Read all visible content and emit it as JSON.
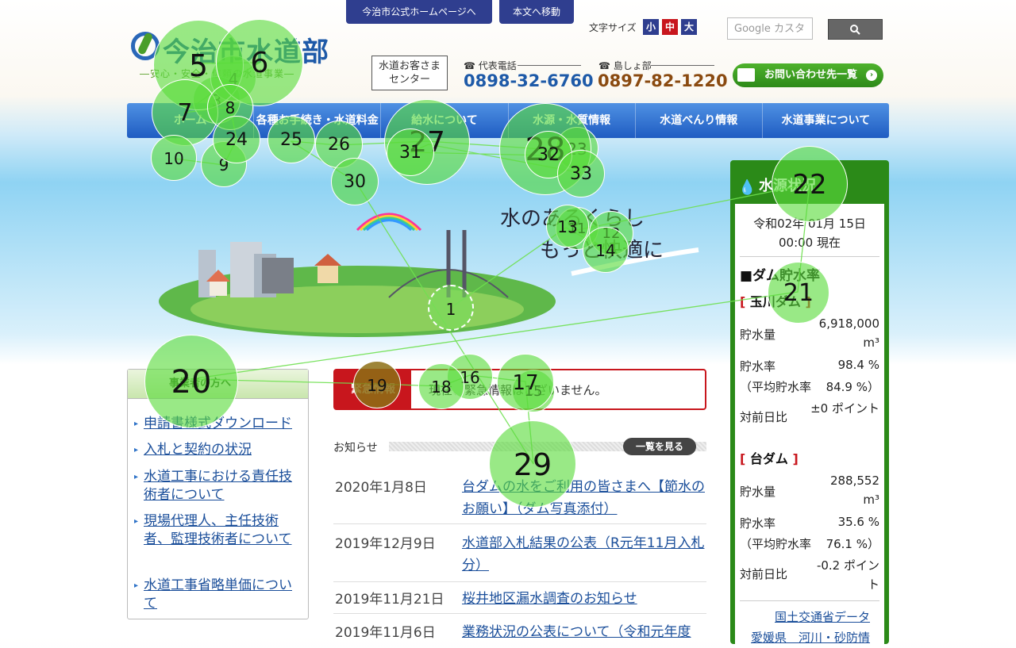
{
  "top": {
    "official_link": "今治市公式ホームページへ",
    "skip_link": "本文へ移動",
    "font_size_label": "文字サイズ",
    "font_sizes": [
      "小",
      "中",
      "大"
    ],
    "search_placeholder": "Google カスタ"
  },
  "logo": {
    "title": "今治市水道部",
    "subtitle": "―安心・安全・信頼の水道事業―"
  },
  "contact": {
    "center_label_1": "水道お客さま",
    "center_label_2": "センター",
    "main_label": "代表電話",
    "main_number": "0898-32-6760",
    "island_label": "島しょ部",
    "island_number": "0897-82-1220",
    "inquiry_button": "お問い合わせ先一覧"
  },
  "nav": [
    "ホーム",
    "各種お手続き・水道料金",
    "給水について",
    "水源・水質情報",
    "水道べんり情報",
    "水道事業について"
  ],
  "hero": {
    "line1": "水のあるくらし",
    "line2": "もっと快適に"
  },
  "left_box": {
    "title": "事業者の方へ",
    "links": [
      "申請書様式ダウンロード",
      "入札と契約の状況",
      "水道工事における責任技術者について",
      "現場代理人、主任技術者、監理技術者について",
      "水道工事省略単価について"
    ]
  },
  "emergency": {
    "label": "緊急情報",
    "text": "現在、緊急情報はございません。"
  },
  "news": {
    "label": "お知らせ",
    "more": "一覧を見る",
    "items": [
      {
        "date": "2020年1月8日",
        "title": "台ダムの水をご利用の皆さまへ【節水のお願い】（ダム写真添付）"
      },
      {
        "date": "2019年12月9日",
        "title": "水道部入札結果の公表（R元年11月入札分）"
      },
      {
        "date": "2019年11月21日",
        "title": "桜井地区漏水調査のお知らせ"
      },
      {
        "date": "2019年11月6日",
        "title": "業務状況の公表について（令和元年度"
      }
    ]
  },
  "water_info": {
    "title": "水源状況",
    "date": "令和02年 01月 15日",
    "time": "00:00 現在",
    "section": "■ダム貯水率",
    "dams": [
      {
        "name": "玉川ダム",
        "volume": "6,918,000",
        "unit": "m³",
        "rate": "98.4 %",
        "avg": "84.9 %",
        "diff": "±0 ポイント"
      },
      {
        "name": "台ダム",
        "volume": "288,552",
        "unit": "m³",
        "rate": "35.6 %",
        "avg": "76.1 %",
        "diff": "-0.2 ポイント"
      }
    ],
    "labels": {
      "volume": "貯水量",
      "rate": "貯水率",
      "avg": "（平均貯水率",
      "diff": "対前日比"
    },
    "links": [
      "国土交通省データ",
      "愛媛県　河川・砂防情"
    ]
  },
  "gaze_fixations": [
    {
      "n": "1"
    },
    {
      "n": "3"
    },
    {
      "n": "4"
    },
    {
      "n": "5"
    },
    {
      "n": "6"
    },
    {
      "n": "7"
    },
    {
      "n": "8"
    },
    {
      "n": "9"
    },
    {
      "n": "10"
    },
    {
      "n": "11"
    },
    {
      "n": "12"
    },
    {
      "n": "13"
    },
    {
      "n": "14"
    },
    {
      "n": "15"
    },
    {
      "n": "16"
    },
    {
      "n": "17"
    },
    {
      "n": "18"
    },
    {
      "n": "19"
    },
    {
      "n": "20"
    },
    {
      "n": "21"
    },
    {
      "n": "22"
    },
    {
      "n": "23"
    },
    {
      "n": "24"
    },
    {
      "n": "25"
    },
    {
      "n": "26"
    },
    {
      "n": "27"
    },
    {
      "n": "28"
    },
    {
      "n": "29"
    },
    {
      "n": "30"
    },
    {
      "n": "31"
    },
    {
      "n": "32"
    },
    {
      "n": "33"
    }
  ]
}
